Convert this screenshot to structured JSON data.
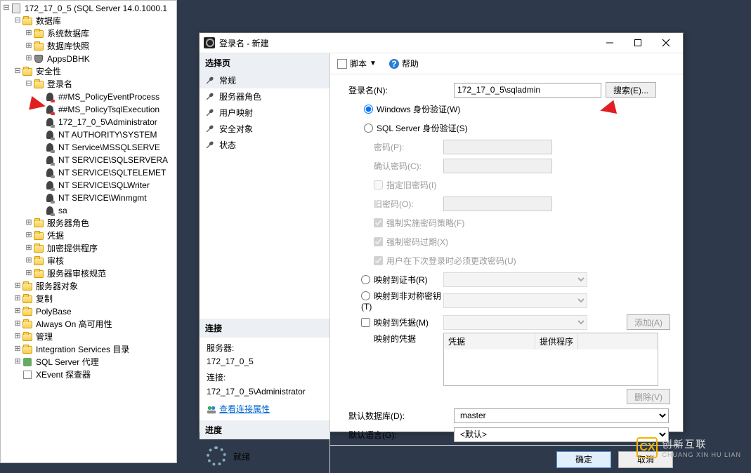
{
  "tree": {
    "root": "172_17_0_5 (SQL Server 14.0.1000.1",
    "db": "数据库",
    "sysdb": "系统数据库",
    "dbsnap": "数据库快照",
    "appsdb": "AppsDBHK",
    "security": "安全性",
    "logins": "登录名",
    "l1": "##MS_PolicyEventProcess",
    "l2": "##MS_PolicyTsqlExecution",
    "l3": "172_17_0_5\\Administrator",
    "l4": "NT AUTHORITY\\SYSTEM",
    "l5": "NT Service\\MSSQLSERVE",
    "l6": "NT SERVICE\\SQLSERVERA",
    "l7": "NT SERVICE\\SQLTELEMET",
    "l8": "NT SERVICE\\SQLWriter",
    "l9": "NT SERVICE\\Winmgmt",
    "l10": "sa",
    "srvroles": "服务器角色",
    "creds": "凭据",
    "cryptprov": "加密提供程序",
    "audit": "审核",
    "srvaudspec": "服务器审核规范",
    "srvobj": "服务器对象",
    "repl": "复制",
    "polybase": "PolyBase",
    "alwayson": "Always On 高可用性",
    "mgmt": "管理",
    "isc": "Integration Services 目录",
    "agent": "SQL Server 代理",
    "xe": "XEvent 探查器"
  },
  "dialog": {
    "title": "登录名 - 新建",
    "select_pages": "选择页",
    "p_general": "常规",
    "p_srvroles": "服务器角色",
    "p_usermap": "用户映射",
    "p_securables": "安全对象",
    "p_status": "状态",
    "connection": "连接",
    "server_lbl": "服务器:",
    "server_val": "172_17_0_5",
    "conn_lbl": "连接:",
    "conn_val": "172_17_0_5\\Administrator",
    "viewprops": "查看连接属性",
    "progress": "进度",
    "ready": "就绪",
    "script": "脚本",
    "help": "帮助"
  },
  "form": {
    "login_lbl": "登录名(N):",
    "login_val": "172_17_0_5\\sqladmin",
    "search": "搜索(E)...",
    "winauth": "Windows 身份验证(W)",
    "sqlauth": "SQL Server 身份验证(S)",
    "pwd": "密码(P):",
    "confirmpwd": "确认密码(C):",
    "specifyold": "指定旧密码(I)",
    "oldpwd": "旧密码(O):",
    "enforce_policy": "强制实施密码策略(F)",
    "enforce_expire": "强制密码过期(X)",
    "mustchange": "用户在下次登录时必须更改密码(U)",
    "mapcert": "映射到证书(R)",
    "mapasym": "映射到非对称密钥(T)",
    "mapcred": "映射到凭据(M)",
    "add": "添加(A)",
    "mappedcreds": "映射的凭据",
    "col_cred": "凭据",
    "col_prov": "提供程序",
    "del": "删除(V)",
    "defdb": "默认数据库(D):",
    "defdb_val": "master",
    "deflang": "默认语言(G):",
    "deflang_val": "<默认>",
    "ok": "确定",
    "cancel": "取消"
  },
  "brand": {
    "name": "创新互联",
    "sub": "CHUANG XIN HU LIAN",
    "logo": "CX"
  }
}
